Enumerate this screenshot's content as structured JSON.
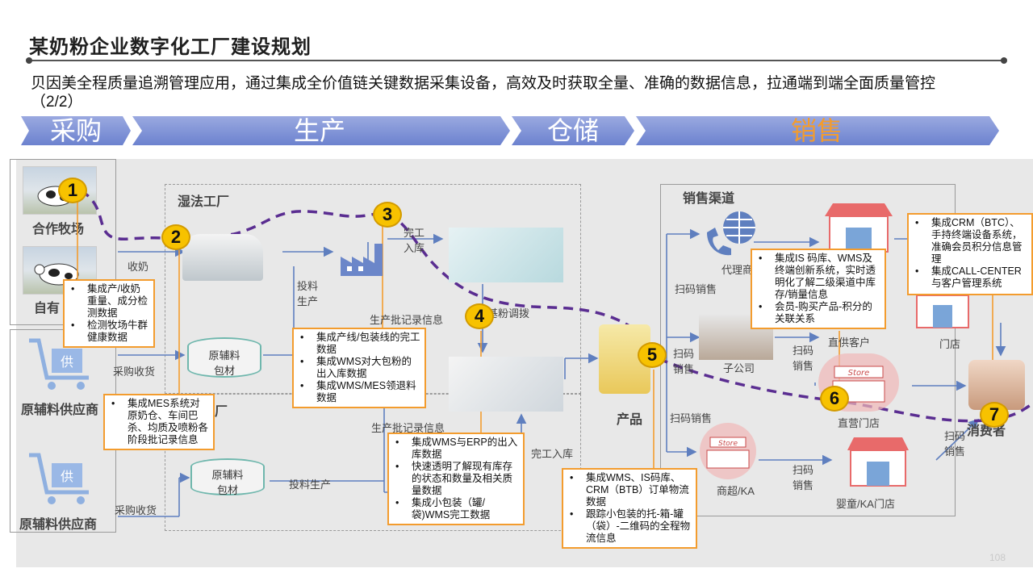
{
  "header": {
    "title": "某奶粉企业数字化工厂建设规划",
    "subtitle": "贝因美全程质量追溯管理应用，通过集成全价值链关键数据采集设备，高效及时获取全量、准确的数据信息，拉通端到端全面质量管控（2/2）"
  },
  "stages": [
    {
      "label": "采购",
      "color": "#7f94d6",
      "text_color": "#ffffff"
    },
    {
      "label": "生产",
      "color": "#7f94d6",
      "text_color": "#ffffff"
    },
    {
      "label": "仓储",
      "color": "#7f94d6",
      "text_color": "#ffffff"
    },
    {
      "label": "销售",
      "color": "#7f94d6",
      "text_color": "#f39c2e"
    }
  ],
  "left": {
    "coop_farm": "合作牧场",
    "own_farm": "自有",
    "supplier1": "原辅料供应商",
    "supplier2": "原辅料供应商",
    "supply_tag": "供"
  },
  "factory": {
    "wet": "湿法工厂",
    "dry_partial": "厂"
  },
  "flow_labels": {
    "collect_milk": "收奶",
    "purchase_receive1": "采购收货",
    "purchase_receive2": "采购收货",
    "raw_material1": "原辅料\n包材",
    "raw_material2": "原辅料\n包材",
    "feed_production1": "投料\n生产",
    "feed_production2": "投料生产",
    "finish_warehouse1": "完工\n入库",
    "finish_warehouse2": "完工入库",
    "batch_record1": "生产批记录信息",
    "batch_record2": "生产批记录信息",
    "bulk_transfer": "基粉调拨",
    "product": "产品"
  },
  "sales": {
    "channel_title": "销售渠道",
    "agent": "代理商",
    "subsidiary": "子公司",
    "direct_customer": "直供客户",
    "direct_store": "直营门店",
    "supermarket": "商超/KA",
    "baby_store": "婴童/KA门店",
    "store": "门店",
    "consumer_partial": "消费者",
    "scan_sale": "扫码销售",
    "store_sign": "Store"
  },
  "badges": [
    "1",
    "2",
    "3",
    "4",
    "5",
    "6",
    "7"
  ],
  "callouts": {
    "c1": [
      "集成产/收奶重量、成分检测数据",
      "检测牧场牛群健康数据"
    ],
    "c2": [
      "集成MES系统对原奶仓、车间巴杀、均质及喷粉各阶段批记录信息"
    ],
    "c3": [
      "集成产线/包装线的完工数据",
      "集成WMS对大包粉的出入库数据",
      "集成WMS/MES领退料数据"
    ],
    "c4": [
      "集成WMS与ERP的出入库数据",
      "快速透明了解现有库存的状态和数量及相关质量数据",
      "集成小包装（罐/袋)WMS完工数据"
    ],
    "c5": [
      "集成WMS、IS码库、CRM（BTB）订单物流数据",
      "跟踪小包装的托-箱-罐（袋）-二维码的全程物流信息"
    ],
    "c6": [
      "集成IS 码库、WMS及终端创新系统，实时透明化了解二级渠道中库存/销量信息",
      "会员-购买产品-积分的关联关系"
    ],
    "c7": [
      "集成CRM（BTC）、手持终端设备系统，准确会员积分信息管理",
      "集成CALL-CENTER与客户管理系统"
    ]
  },
  "page_number": "108",
  "colors": {
    "accent_orange": "#f39c2e",
    "badge_yellow": "#f7c200",
    "path_purple": "#5a2d91",
    "arrow_blue": "#5f7fbf",
    "stage_blue": "#7f94d6"
  }
}
